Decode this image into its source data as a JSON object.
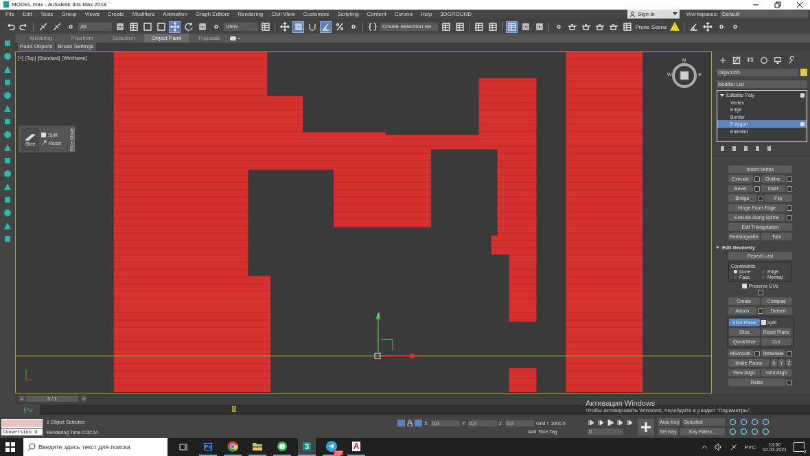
{
  "window": {
    "title": "MODEL.max - Autodesk 3ds Max 2018"
  },
  "menu": [
    "File",
    "Edit",
    "Tools",
    "Group",
    "Views",
    "Create",
    "Modifiers",
    "Animation",
    "Graph Editors",
    "Rendering",
    "Civil View",
    "Customize",
    "Scripting",
    "Content",
    "Corona",
    "Help",
    "3DGROUND"
  ],
  "account": {
    "sign_in": "Sign In",
    "workspaces_label": "Workspaces:",
    "workspace": "Default"
  },
  "toolbar": [
    {
      "kind": "undo",
      "selected": false
    },
    {
      "kind": "redo",
      "selected": false
    },
    {
      "kind": "sep"
    },
    {
      "kind": "link",
      "selected": false
    },
    {
      "kind": "link",
      "selected": false
    },
    {
      "kind": "dot",
      "selected": false
    },
    {
      "kind": "dropdown",
      "label": "All"
    },
    {
      "kind": "square",
      "selected": false
    },
    {
      "kind": "table",
      "selected": false
    },
    {
      "kind": "frame",
      "selected": false
    },
    {
      "kind": "frame",
      "selected": false
    },
    {
      "kind": "cross",
      "selected": true
    },
    {
      "kind": "rotate",
      "selected": false
    },
    {
      "kind": "square",
      "selected": false
    },
    {
      "kind": "dot",
      "selected": false
    },
    {
      "kind": "dropdown",
      "label": "View"
    },
    {
      "kind": "table",
      "selected": false
    },
    {
      "kind": "sep"
    },
    {
      "kind": "cross",
      "selected": false
    },
    {
      "kind": "square",
      "selected": true
    },
    {
      "kind": "magnet",
      "selected": false
    },
    {
      "kind": "angle",
      "selected": true
    },
    {
      "kind": "percent",
      "selected": false
    },
    {
      "kind": "dot",
      "selected": false
    },
    {
      "kind": "sep"
    },
    {
      "kind": "brace",
      "selected": false
    },
    {
      "kind": "dropdown",
      "label": "Create Selection Se"
    },
    {
      "kind": "table",
      "selected": false
    },
    {
      "kind": "table",
      "selected": false
    },
    {
      "kind": "sep"
    },
    {
      "kind": "table",
      "selected": false
    },
    {
      "kind": "table",
      "selected": false
    },
    {
      "kind": "sep"
    },
    {
      "kind": "table",
      "selected": true
    },
    {
      "kind": "square",
      "selected": false
    },
    {
      "kind": "square",
      "selected": false
    },
    {
      "kind": "sep"
    },
    {
      "kind": "dot",
      "selected": false
    },
    {
      "kind": "teapot",
      "selected": false
    },
    {
      "kind": "teapot",
      "selected": false
    },
    {
      "kind": "teapot",
      "selected": false
    },
    {
      "kind": "teapot",
      "selected": false
    },
    {
      "kind": "table",
      "selected": false
    },
    {
      "kind": "text",
      "label": "Prune Scene"
    },
    {
      "kind": "warning",
      "selected": false
    },
    {
      "kind": "sep"
    },
    {
      "kind": "angle",
      "selected": false
    },
    {
      "kind": "cross",
      "selected": false
    },
    {
      "kind": "dot",
      "selected": false
    },
    {
      "kind": "dot",
      "selected": false
    }
  ],
  "ribbon": {
    "tabs": [
      {
        "label": "Modeling",
        "selected": false
      },
      {
        "label": "Freeform",
        "selected": false
      },
      {
        "label": "Selection",
        "selected": false
      },
      {
        "label": "Object Paint",
        "selected": true
      },
      {
        "label": "Populate",
        "selected": false
      }
    ],
    "subtabs": [
      "Paint Objects",
      "Brush Settings"
    ]
  },
  "viewport": {
    "labels": [
      "[+]",
      "[Top]",
      "[Standard]",
      "[Wireframe]"
    ],
    "slice_caddy": {
      "button": "Slice",
      "split": {
        "label": "Split",
        "checked": false
      },
      "reset": "Reset",
      "mode": "Slice Mode"
    },
    "compass": {
      "north": "N",
      "west": "W",
      "east": "E"
    },
    "axis_label": "y"
  },
  "command_panel": {
    "tabs": [
      {
        "kind": "create",
        "selected": false
      },
      {
        "kind": "modify",
        "selected": true
      },
      {
        "kind": "hierarchy",
        "selected": false
      },
      {
        "kind": "motion",
        "selected": false
      },
      {
        "kind": "display",
        "selected": false
      },
      {
        "kind": "utilities",
        "selected": false
      }
    ],
    "object_name": "Object255",
    "modifier_list": "Modifier List",
    "stack": [
      {
        "label": "Editable Poly",
        "expanded": true,
        "selected": false,
        "children": [
          {
            "label": "Vertex",
            "selected": false
          },
          {
            "label": "Edge",
            "selected": false
          },
          {
            "label": "Border",
            "selected": false
          },
          {
            "label": "Polygon",
            "selected": true
          },
          {
            "label": "Element",
            "selected": false
          }
        ]
      }
    ],
    "edit_polygons": {
      "groups": [
        {
          "boxed": false,
          "rows": [
            [
              {
                "kind": "button",
                "label": "Insert Vertex",
                "settings": false,
                "active": false
              }
            ],
            [
              {
                "kind": "button",
                "label": "Extrude",
                "settings": true,
                "active": false
              },
              {
                "kind": "button",
                "label": "Outline",
                "settings": true,
                "active": false
              }
            ],
            [
              {
                "kind": "button",
                "label": "Bevel",
                "settings": true,
                "active": false
              },
              {
                "kind": "button",
                "label": "Inset",
                "settings": true,
                "active": false
              }
            ],
            [
              {
                "kind": "button",
                "label": "Bridge",
                "settings": true,
                "active": false
              },
              {
                "kind": "button",
                "label": "Flip",
                "settings": false,
                "active": false
              }
            ],
            [
              {
                "kind": "button",
                "label": "Hinge From Edge",
                "settings": true,
                "active": false
              }
            ],
            [
              {
                "kind": "button",
                "label": "Extrude Along Spline",
                "settings": true,
                "active": false
              }
            ],
            [
              {
                "kind": "button",
                "label": "Edit Triangulation",
                "settings": false,
                "active": false
              }
            ],
            [
              {
                "kind": "button",
                "label": "Retriangulate",
                "settings": false,
                "active": false
              },
              {
                "kind": "button",
                "label": "Turn",
                "settings": false,
                "active": false
              }
            ]
          ]
        }
      ]
    },
    "edit_geometry": {
      "title": "Edit Geometry",
      "expanded": true,
      "repeat": "Repeat Last",
      "constraints": {
        "label": "Constraints",
        "options": [
          {
            "label": "None",
            "selected": true
          },
          {
            "label": "Edge",
            "selected": false
          },
          {
            "label": "Face",
            "selected": false
          },
          {
            "label": "Normal",
            "selected": false
          }
        ]
      },
      "preserve_uvs": {
        "label": "Preserve UVs",
        "checked": false
      },
      "groups": [
        {
          "boxed": false,
          "rows": [
            [
              {
                "kind": "button",
                "label": "Create",
                "settings": false,
                "active": false
              },
              {
                "kind": "button",
                "label": "Collapse",
                "settings": false,
                "active": false
              }
            ],
            [
              {
                "kind": "button",
                "label": "Attach",
                "settings": true,
                "active": false
              },
              {
                "kind": "button",
                "label": "Detach",
                "settings": false,
                "active": false
              }
            ]
          ]
        },
        {
          "boxed": true,
          "rows": [
            [
              {
                "kind": "button",
                "label": "Slice Plane",
                "settings": false,
                "active": true
              },
              {
                "kind": "checkbox",
                "label": "Split",
                "checked": false
              }
            ],
            [
              {
                "kind": "button",
                "label": "Slice",
                "settings": false,
                "active": false
              },
              {
                "kind": "button",
                "label": "Reset Plane",
                "settings": false,
                "active": false
              }
            ],
            [
              {
                "kind": "button",
                "label": "QuickSlice",
                "settings": false,
                "active": false
              },
              {
                "kind": "button",
                "label": "Cut",
                "settings": false,
                "active": false
              }
            ]
          ]
        },
        {
          "boxed": false,
          "rows": [
            [
              {
                "kind": "button",
                "label": "MSmooth",
                "settings": true,
                "active": false
              },
              {
                "kind": "button",
                "label": "Tessellate",
                "settings": true,
                "active": false
              }
            ],
            [
              {
                "kind": "button",
                "label": "Make Planar",
                "settings": false,
                "active": false
              },
              {
                "kind": "button",
                "label": "X",
                "settings": false,
                "active": false
              },
              {
                "kind": "button",
                "label": "Y",
                "settings": false,
                "active": false
              },
              {
                "kind": "button",
                "label": "Z",
                "settings": false,
                "active": false
              }
            ],
            [
              {
                "kind": "button",
                "label": "View Align",
                "settings": false,
                "active": false
              },
              {
                "kind": "button",
                "label": "Grid Align",
                "settings": false,
                "active": false
              }
            ],
            [
              {
                "kind": "button",
                "label": "Relax",
                "settings": true,
                "active": false
              }
            ]
          ]
        }
      ]
    }
  },
  "time_slider": {
    "prev": "<",
    "position": "0 / 1",
    "next": ">",
    "level": 0
  },
  "track_bar": {
    "marker": "0"
  },
  "status": {
    "maxscript": "Conversion d",
    "selection": "1 Object Selected",
    "render_time": "Rendering Time  0:00:14",
    "coords": [
      {
        "label": "X:",
        "value": "0,0"
      },
      {
        "label": "Y:",
        "value": "0,0"
      },
      {
        "label": "Z:",
        "value": "0,0"
      }
    ],
    "grid": "Grid = 1000,0",
    "time_tag": "Add Time Tag",
    "frame": "0",
    "auto_key": "Auto Key",
    "set_key": "Set Key",
    "key_mode": "Selected",
    "key_filters": "Key Filters..."
  },
  "activation": {
    "title": "Активация Windows",
    "text": "Чтобы активировать Windows, перейдите в раздел \"Параметры\"."
  },
  "taskbar": {
    "search_placeholder": "Введите здесь текст для поиска",
    "apps": [
      {
        "kind": "photoshop",
        "label": "Ps",
        "active": false
      },
      {
        "kind": "chrome",
        "active": false
      },
      {
        "kind": "folder",
        "active": false
      },
      {
        "kind": "whatsapp",
        "active": false
      },
      {
        "kind": "max",
        "label": "3",
        "active": true
      },
      {
        "kind": "telegram",
        "badge": "287",
        "active": false
      },
      {
        "kind": "autocad",
        "label": "A",
        "active": false
      }
    ],
    "language": "РУС",
    "time": "13:50",
    "date": "12.03.2021",
    "notifications": "2"
  }
}
